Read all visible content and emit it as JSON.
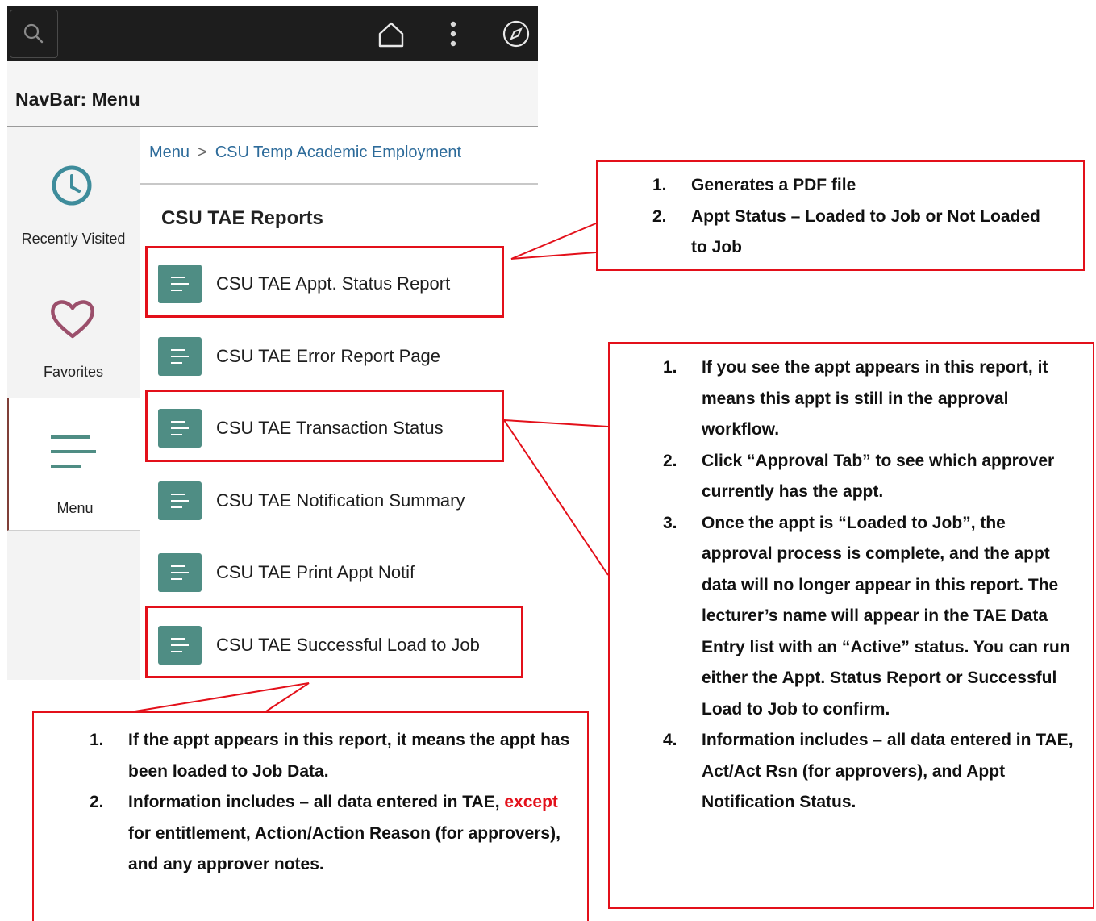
{
  "topbar": {
    "search_icon": "search-icon",
    "home_icon": "home-icon",
    "actions_icon": "vertical-dots-icon",
    "navbar_icon": "compass-icon"
  },
  "navbar": {
    "title": "NavBar: Menu"
  },
  "sidebar": {
    "items": [
      {
        "label": "Recently Visited",
        "icon": "clock-icon"
      },
      {
        "label": "Favorites",
        "icon": "heart-icon"
      },
      {
        "label": "Menu",
        "icon": "menu-lines-icon"
      }
    ]
  },
  "breadcrumb": {
    "root": "Menu",
    "separator": ">",
    "current": "CSU Temp Academic Employment"
  },
  "section": {
    "title": "CSU TAE Reports"
  },
  "reports": [
    {
      "label": "CSU TAE Appt. Status Report"
    },
    {
      "label": "CSU TAE Error Report Page"
    },
    {
      "label": "CSU TAE Transaction Status"
    },
    {
      "label": "CSU TAE Notification Summary"
    },
    {
      "label": "CSU TAE Print Appt Notif"
    },
    {
      "label": "CSU TAE Successful Load to Job"
    }
  ],
  "callouts": {
    "appt_status": {
      "items": [
        {
          "num": "1.",
          "text": "Generates a PDF file"
        },
        {
          "num": "2.",
          "text": "Appt Status – Loaded to Job or Not Loaded to Job"
        }
      ]
    },
    "transaction_status": {
      "items": [
        {
          "num": "1.",
          "text": "If you see the appt appears in this report, it means this appt is still in the approval workflow."
        },
        {
          "num": "2.",
          "text": "Click “Approval Tab” to see which approver currently has the appt."
        },
        {
          "num": "3.",
          "text": "Once the appt is “Loaded to Job”, the approval process is complete, and the appt data will no longer appear in this report. The lecturer’s name will appear in the TAE Data Entry list with an “Active” status. You can run either the Appt. Status Report or Successful Load to Job to confirm."
        },
        {
          "num": "4.",
          "text": "Information includes – all data entered in TAE, Act/Act Rsn (for approvers), and Appt Notification Status."
        }
      ]
    },
    "successful_load": {
      "items": [
        {
          "num": "1.",
          "text": "If the appt appears in this report, it means the appt has been loaded to Job Data."
        },
        {
          "num": "2.",
          "text_before": "Information includes – all data entered in TAE, ",
          "highlight": "except",
          "text_after": " for entitlement, Action/Action Reason (for approvers), and any approver notes."
        }
      ]
    }
  },
  "colors": {
    "annotation_red": "#e3101a",
    "report_icon_teal": "#4f8d84",
    "breadcrumb_blue": "#2d6b9a",
    "topbar_dark": "#1d1d1d"
  }
}
